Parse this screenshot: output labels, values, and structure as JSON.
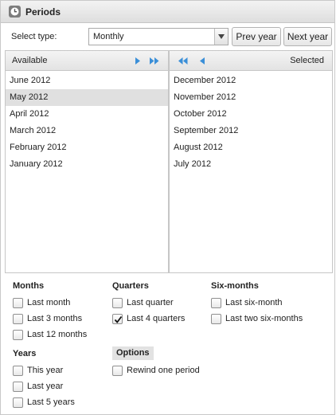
{
  "header": {
    "title": "Periods",
    "icon": "clock-icon"
  },
  "toolbar": {
    "type_label": "Select type:",
    "type_value": "Monthly",
    "prev_label": "Prev year",
    "next_label": "Next year"
  },
  "available": {
    "label": "Available",
    "items": [
      "June 2012",
      "May 2012",
      "April 2012",
      "March 2012",
      "February 2012",
      "January 2012"
    ],
    "selected_item": "May 2012"
  },
  "selected": {
    "label": "Selected",
    "items": [
      "December 2012",
      "November 2012",
      "October 2012",
      "September 2012",
      "August 2012",
      "July 2012"
    ]
  },
  "groups": {
    "months": {
      "title": "Months",
      "options": [
        {
          "label": "Last month",
          "checked": false
        },
        {
          "label": "Last 3 months",
          "checked": false
        },
        {
          "label": "Last 12 months",
          "checked": false
        }
      ]
    },
    "quarters": {
      "title": "Quarters",
      "options": [
        {
          "label": "Last quarter",
          "checked": false
        },
        {
          "label": "Last 4 quarters",
          "checked": true
        }
      ]
    },
    "sixmonths": {
      "title": "Six-months",
      "options": [
        {
          "label": "Last six-month",
          "checked": false
        },
        {
          "label": "Last two six-months",
          "checked": false
        }
      ]
    },
    "years": {
      "title": "Years",
      "options": [
        {
          "label": "This year",
          "checked": false
        },
        {
          "label": "Last year",
          "checked": false
        },
        {
          "label": "Last 5 years",
          "checked": false
        }
      ]
    },
    "options": {
      "title": "Options",
      "options": [
        {
          "label": "Rewind one period",
          "checked": false
        }
      ]
    }
  },
  "colors": {
    "arrow": "#3a8fd8",
    "selected_row": "#e0e0e0"
  }
}
